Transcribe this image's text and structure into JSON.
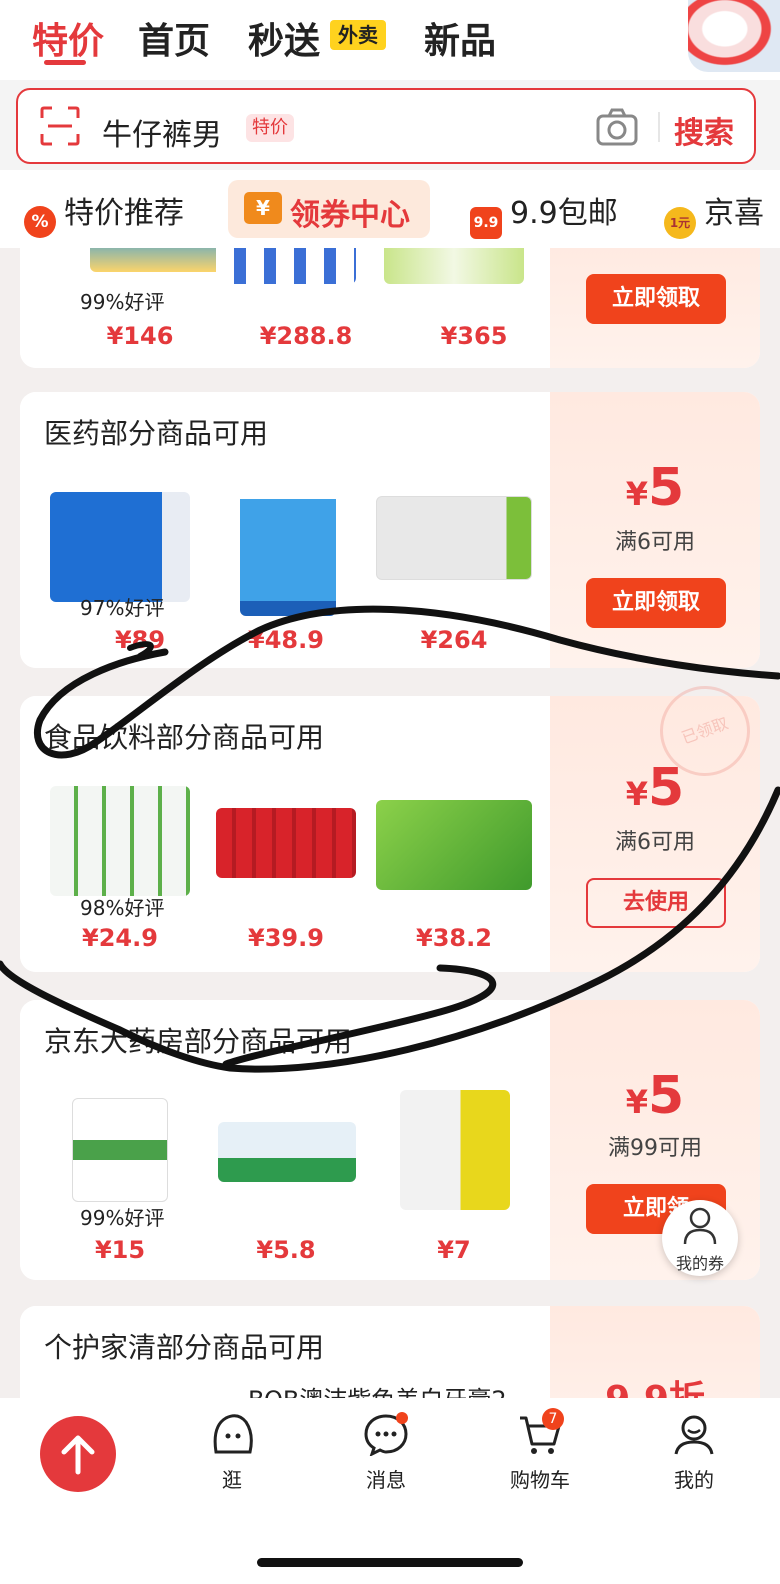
{
  "topnav": {
    "tabs": [
      "特价",
      "首页",
      "秒送",
      "新品"
    ],
    "waimai_badge": "外卖"
  },
  "search": {
    "query": "牛仔裤男",
    "tag": "特价",
    "button": "搜索"
  },
  "categories": {
    "items": [
      "特价推荐",
      "领券中心",
      "9.9包邮",
      "京喜"
    ],
    "badge_pct": "%",
    "badge_99": "9.9",
    "badge_1": "1元",
    "badge_yen": "¥"
  },
  "coupons": [
    {
      "title": "",
      "rating": "99%好评",
      "prices": [
        "¥146",
        "¥288.8",
        "¥365"
      ],
      "amount_yen": "",
      "amount": "",
      "condition": "",
      "button": "立即领取"
    },
    {
      "title": "医药部分商品可用",
      "rating": "97%好评",
      "prices": [
        "¥89",
        "¥48.9",
        "¥264"
      ],
      "amount_yen": "¥",
      "amount": "5",
      "condition": "满6可用",
      "button": "立即领取"
    },
    {
      "title": "食品饮料部分商品可用",
      "rating": "98%好评",
      "prices": [
        "¥24.9",
        "¥39.9",
        "¥38.2"
      ],
      "amount_yen": "¥",
      "amount": "5",
      "condition": "满6可用",
      "button": "去使用",
      "stamp": "已领取"
    },
    {
      "title": "京东大药房部分商品可用",
      "rating": "99%好评",
      "prices": [
        "¥15",
        "¥5.8",
        "¥7"
      ],
      "amount_yen": "¥",
      "amount": "5",
      "condition": "满99可用",
      "button": "立即领"
    },
    {
      "title": "个护家清部分商品可用",
      "partial_text": "BOB澳洁紫色美白牙膏2",
      "amount": "9.9折"
    }
  ],
  "float_button": {
    "label": "我的券"
  },
  "bottomnav": {
    "items": [
      "逛",
      "消息",
      "购物车",
      "我的"
    ],
    "cart_count": "7"
  },
  "colors": {
    "accent": "#e4393c",
    "button": "#f0431c",
    "coupon_bg": "#ffe9e0"
  }
}
